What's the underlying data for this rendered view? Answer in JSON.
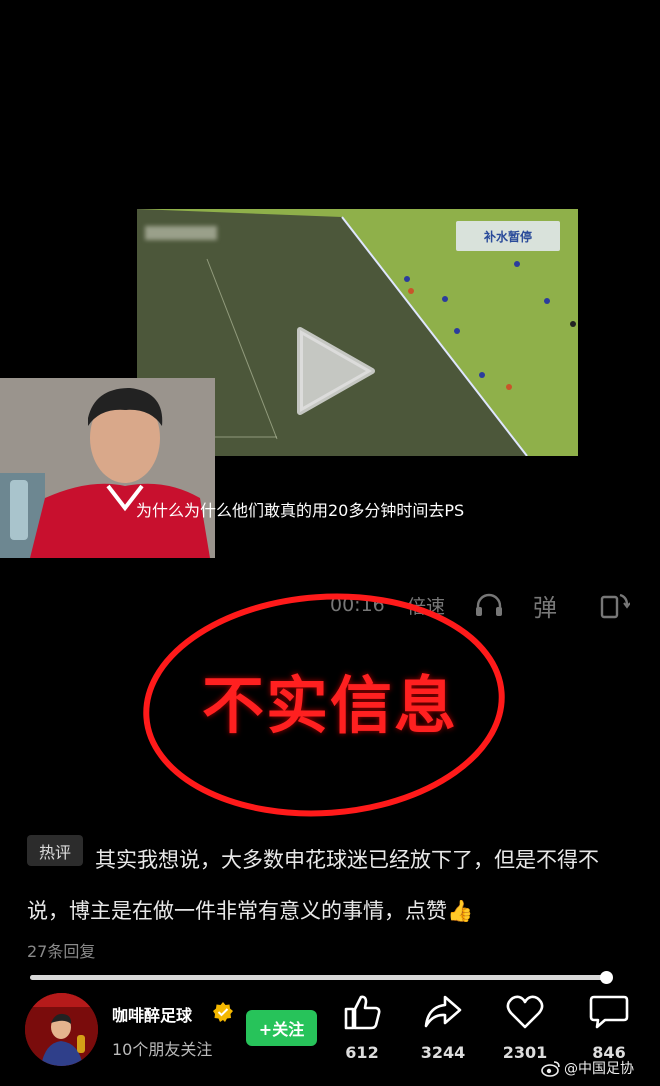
{
  "video": {
    "badge": "补水暂停",
    "caption": "为什么为什么他们敢真的用20多分钟时间去PS"
  },
  "controls": {
    "time": "00:16",
    "speed_label": "倍速",
    "danmaku_label": "弹"
  },
  "stamp": {
    "text": "不实信息",
    "color": "#ff2020"
  },
  "comment": {
    "badge": "热评",
    "text": "其实我想说，大多数申花球迷已经放下了，但是不得不说，博主是在做一件非常有意义的事情，点赞👍",
    "replies": "27条回复"
  },
  "progress": {
    "value": 0.99
  },
  "author": {
    "name": "咖啡醉足球",
    "friends": "10个朋友关注",
    "follow_label": "+关注"
  },
  "actions": {
    "like": "612",
    "share": "3244",
    "favorite": "2301",
    "comment": "846"
  },
  "watermark": "@中国足协",
  "colors": {
    "accent_green": "#27c35a",
    "stamp_red": "#ff2020"
  }
}
